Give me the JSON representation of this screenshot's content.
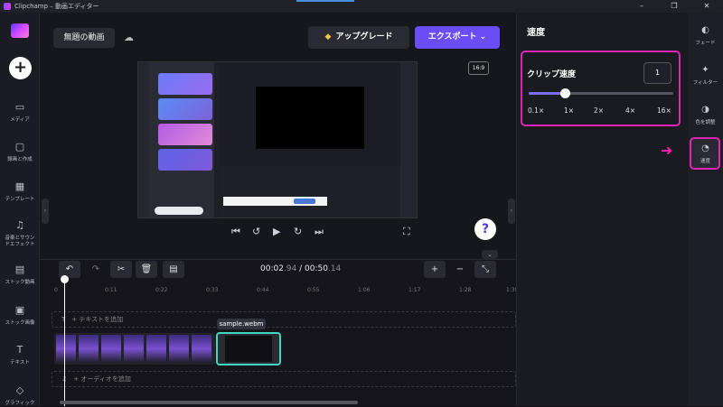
{
  "window": {
    "title": "Clipchamp – 動画エディター",
    "controls": [
      "–",
      "❐",
      "✕"
    ]
  },
  "rail": {
    "items": [
      {
        "icon": "media-icon",
        "glyph": "▭",
        "label": "メディア"
      },
      {
        "icon": "record-icon",
        "glyph": "▢",
        "label": "録画と作成"
      },
      {
        "icon": "template-icon",
        "glyph": "▦",
        "label": "テンプレート"
      },
      {
        "icon": "music-icon",
        "glyph": "♫",
        "label": "音楽とサウン\nドエフェクト"
      },
      {
        "icon": "stock-video-icon",
        "glyph": "▤",
        "label": "ストック動画"
      },
      {
        "icon": "stock-image-icon",
        "glyph": "▣",
        "label": "ストック画像"
      },
      {
        "icon": "text-icon",
        "glyph": "T",
        "label": "テキスト"
      },
      {
        "icon": "graphics-icon",
        "glyph": "◇",
        "label": "グラフィック"
      }
    ]
  },
  "header": {
    "project_name": "無題の動画",
    "upgrade_label": "アップグレード",
    "export_label": "エクスポート"
  },
  "preview": {
    "aspect_ratio": "16:9"
  },
  "timeline": {
    "current_time": "00:02",
    "current_frac": ".94",
    "separator": " / ",
    "total_time": "00:50",
    "total_frac": ".14",
    "ruler": [
      "0",
      "0:11",
      "0:22",
      "0:33",
      "0:44",
      "0:55",
      "1:06",
      "1:17",
      "1:28",
      "1:39"
    ],
    "text_track": "T　+ テキストを追加",
    "audio_track": "♫　+ オーディオを追加",
    "clip_label": "sample.webm"
  },
  "panel": {
    "title": "速度",
    "speed_label": "クリップ速度",
    "speed_value": "1",
    "slider_fraction": 0.25,
    "ticks": [
      "0.1×",
      "1×",
      "2×",
      "4×",
      "16×"
    ]
  },
  "tools": [
    {
      "icon": "fade-icon",
      "glyph": "◐",
      "label": "フェード"
    },
    {
      "icon": "filter-icon",
      "glyph": "✦",
      "label": "フィルター"
    },
    {
      "icon": "color-adjust-icon",
      "glyph": "◑",
      "label": "色を調整"
    },
    {
      "icon": "speed-icon",
      "glyph": "◔",
      "label": "速度"
    }
  ],
  "colors": {
    "accent": "#6a4df5",
    "highlight": "#e024b8",
    "clip_border": "#3fd8c3"
  }
}
